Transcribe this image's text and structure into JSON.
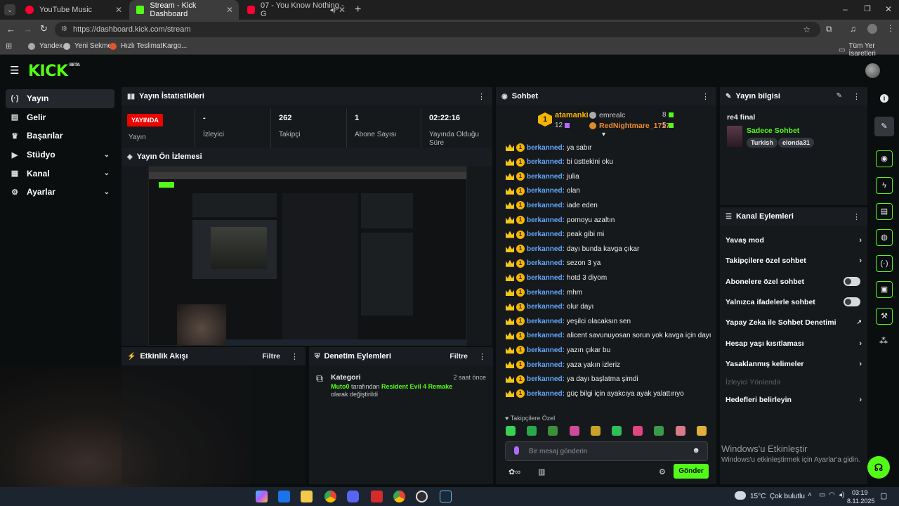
{
  "browser": {
    "tabs": [
      {
        "title": "YouTube Music",
        "color": "#ff0033"
      },
      {
        "title": "Stream - Kick Dashboard",
        "color": "#53fc18"
      },
      {
        "title": "07 - You Know Nothing - G",
        "color": "#ff0033"
      }
    ],
    "url": "https://dashboard.kick.com/stream",
    "bookmarks": [
      "Yandex",
      "Yeni Sekme",
      "Hızlı TeslimatKargo..."
    ],
    "all_bookmarks": "Tüm Yer İşaretleri"
  },
  "app": {
    "logo": "KICK",
    "logo_beta": "BETA",
    "accent": "#53fc18",
    "sidebar": [
      {
        "label": "Yayın",
        "icon": "broadcast-icon",
        "glyph": "(·)",
        "chev": ""
      },
      {
        "label": "Gelir",
        "icon": "wallet-icon",
        "glyph": "▤",
        "chev": ""
      },
      {
        "label": "Başarılar",
        "icon": "trophy-icon",
        "glyph": "♛",
        "chev": ""
      },
      {
        "label": "Stüdyo",
        "icon": "video-icon",
        "glyph": "▶",
        "chev": "⌄"
      },
      {
        "label": "Kanal",
        "icon": "channel-icon",
        "glyph": "▦",
        "chev": "⌄"
      },
      {
        "label": "Ayarlar",
        "icon": "gear-icon",
        "glyph": "⚙",
        "chev": "⌄"
      }
    ],
    "stats": {
      "title": "Yayın İstatistikleri",
      "live_badge": "YAYINDA",
      "items": [
        {
          "value": "",
          "label": "Yayın"
        },
        {
          "value": "-",
          "label": "İzleyici"
        },
        {
          "value": "262",
          "label": "Takipçi"
        },
        {
          "value": "1",
          "label": "Abone Sayısı"
        },
        {
          "value": "02:22:16",
          "label": "Yayında Olduğu Süre"
        }
      ]
    },
    "preview_title": "Yayın Ön İzlemesi",
    "activity": {
      "title": "Etkinlik Akışı",
      "filter": "Filtre"
    },
    "moderation": {
      "title": "Denetim Eylemleri",
      "filter": "Filtre",
      "item_title": "Kategori",
      "time": "2 saat önce",
      "actor": "Muto0",
      "middle": " tarafından ",
      "game": "Resident Evil 4 Remake",
      "suffix": " olarak değiştirildi"
    },
    "chat": {
      "title": "Sohbet",
      "top_rank": "1",
      "top_user": "atamanki",
      "top_count": "12",
      "ranks": [
        {
          "user": "emrealc",
          "count": "8"
        },
        {
          "user": "RedNightmare_1717",
          "count": "5"
        }
      ],
      "messages": [
        {
          "user": "berkanned:",
          "text": "ya sabır"
        },
        {
          "user": "berkanned:",
          "text": "bi üsttekini oku"
        },
        {
          "user": "berkanned:",
          "text": "julia"
        },
        {
          "user": "berkanned:",
          "text": "olan"
        },
        {
          "user": "berkanned:",
          "text": "iade eden"
        },
        {
          "user": "berkanned:",
          "text": "pornoyu azaltın"
        },
        {
          "user": "berkanned:",
          "text": "peak gibi mi"
        },
        {
          "user": "berkanned:",
          "text": "dayı bunda kavga çıkar"
        },
        {
          "user": "berkanned:",
          "text": "sezon 3 ya"
        },
        {
          "user": "berkanned:",
          "text": "hotd 3 diyom"
        },
        {
          "user": "berkanned:",
          "text": "mhm"
        },
        {
          "user": "berkanned:",
          "text": "olur dayı"
        },
        {
          "user": "berkanned:",
          "text": "yeşilci olacaksın sen"
        },
        {
          "user": "berkanned:",
          "text": "alicent savunuyosan sorun yok kavga için dayı"
        },
        {
          "user": "berkanned:",
          "text": "yazın çıkar bu"
        },
        {
          "user": "berkanned:",
          "text": "yaza yakın izleriz"
        },
        {
          "user": "berkanned:",
          "text": "ya dayı başlatma şimdi"
        },
        {
          "user": "berkanned:",
          "text": "güç bilgi için ayakcıya ayak yalattırıyo"
        }
      ],
      "followers_only": "Takipçilere Özel",
      "placeholder": "Bir mesaj gönderin",
      "send": "Gönder",
      "emote_colors": [
        "#39d353",
        "#2aa84a",
        "#3b8f3b",
        "#d04a9a",
        "#c9a227",
        "#2fbf5a",
        "#e0457b",
        "#3a9a4a",
        "#d97a8a",
        "#e0b13a"
      ]
    },
    "stream_info": {
      "title": "Yayın bilgisi",
      "stream_title": "re4 final",
      "mode": "Sadece Sohbet",
      "tags": [
        "Turkish",
        "elonda31"
      ]
    },
    "channel_actions": {
      "title": "Kanal Eylemleri",
      "items": [
        {
          "label": "Yavaş mod",
          "control": "chev"
        },
        {
          "label": "Takipçilere özel sohbet",
          "control": "chev"
        },
        {
          "label": "Abonelere özel sohbet",
          "control": "toggle"
        },
        {
          "label": "Yalnızca ifadelerle sohbet",
          "control": "toggle"
        },
        {
          "label": "Yapay Zeka ile Sohbet Denetimi",
          "control": "ext"
        },
        {
          "label": "Hesap yaşı kısıtlaması",
          "control": "chev"
        },
        {
          "label": "Yasaklanmış kelimeler",
          "control": "chev"
        }
      ],
      "muted": "İzleyici Yönlendir",
      "last": "Hedefleri belirleyin"
    },
    "windows_activation": {
      "title": "Windows'u Etkinleştir",
      "subtitle": "Windows'u etkinleştirmek için Ayarlar'a gidin."
    }
  },
  "taskbar": {
    "weather": "15°C  Çok bulutlu",
    "time": "03:19",
    "date": "8.11.2025"
  }
}
